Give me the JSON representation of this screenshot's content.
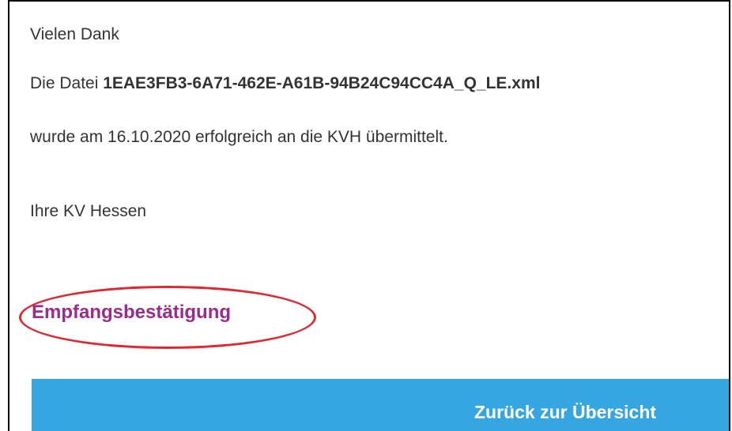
{
  "message": {
    "thanks": "Vielen Dank",
    "file_prefix": "Die Datei ",
    "file_name": "1EAE3FB3-6A71-462E-A61B-94B24C94CC4A_Q_LE.xml",
    "sent_text": "wurde am 16.10.2020 erfolgreich an die KVH übermittelt.",
    "signature": "Ihre KV Hessen"
  },
  "receipt_link": {
    "label": "Empfangsbestätigung"
  },
  "back_button": {
    "label": "Zurück zur Übersicht"
  },
  "colors": {
    "link": "#9b2a8f",
    "highlight": "#e3262e",
    "button": "#36a6e0",
    "text": "#333333"
  }
}
